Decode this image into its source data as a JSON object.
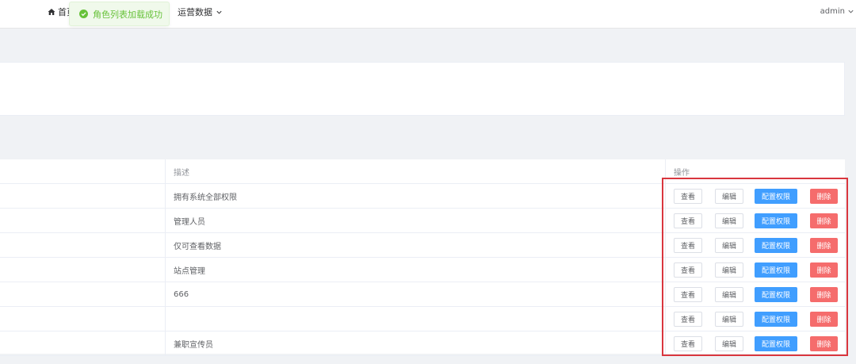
{
  "topbar": {
    "home_label": "首页",
    "ops_menu_label": "运营数据",
    "user_label": "admin"
  },
  "toast": {
    "message": "角色列表加载成功"
  },
  "table": {
    "columns": {
      "description": "描述",
      "actions": "操作"
    },
    "rows": [
      {
        "description": "拥有系统全部权限"
      },
      {
        "description": "管理人员"
      },
      {
        "description": "仅可查看数据"
      },
      {
        "description": "站点管理"
      },
      {
        "description": "666"
      },
      {
        "description": ""
      },
      {
        "description": "兼职宣传员"
      }
    ],
    "actions": {
      "view": "查看",
      "edit": "编辑",
      "permissions": "配置权限",
      "delete": "删除"
    }
  },
  "colors": {
    "primary": "#409eff",
    "danger": "#f56c6c",
    "success": "#67c23a",
    "annotation": "#d9363e"
  },
  "icons": {
    "home": "home-icon",
    "toast": "check-circle-icon",
    "dropdown": "chevron-down-icon"
  }
}
